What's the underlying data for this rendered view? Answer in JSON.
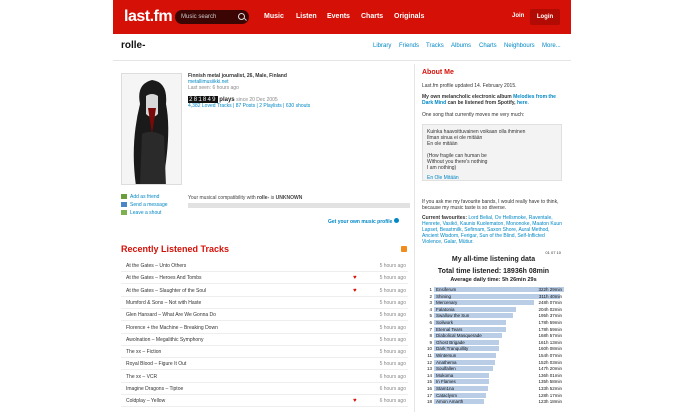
{
  "header": {
    "logo": "last.fm",
    "search_placeholder": "Music search",
    "nav": [
      "Music",
      "Listen",
      "Events",
      "Charts",
      "Originals"
    ],
    "join": "Join",
    "login": "Login"
  },
  "profile": {
    "username": "rolle-",
    "subnav": [
      "Library",
      "Friends",
      "Tracks",
      "Albums",
      "Charts",
      "Neighbours",
      "More..."
    ],
    "bio_line1": "Finnish metal journalist, 26, Male, Finland",
    "bio_line2": "metallimusiikki.net",
    "bio_line3": "Last seen: 6 hours ago",
    "scrobbles": "281849",
    "plays_label": "plays",
    "since": "since 20 Dec 2005",
    "links": "4,382 Loved Tracks | 87 Posts | 2 Playlists | 630 shouts",
    "actions": [
      "Add as friend",
      "Send a message",
      "Leave a shout"
    ],
    "compat_prefix": "Your musical compatibility with",
    "compat_user": "rolle-",
    "compat_suffix": "is",
    "compat_level": "UNKNOWN",
    "get_own": "Get your own music profile"
  },
  "recent": {
    "title": "Recently Listened Tracks",
    "tracks": [
      {
        "title": "At the Gates – Unto Others",
        "loved": false,
        "time": "5 hours ago"
      },
      {
        "title": "At the Gates – Heroes And Tombs",
        "loved": true,
        "time": "5 hours ago"
      },
      {
        "title": "At the Gates – Slaughter of the Soul",
        "loved": true,
        "time": "5 hours ago"
      },
      {
        "title": "Mumford & Sons – Not with Haste",
        "loved": false,
        "time": "5 hours ago"
      },
      {
        "title": "Glen Hansard – What Are We Gonna Do",
        "loved": false,
        "time": "5 hours ago"
      },
      {
        "title": "Florence + the Machine – Breaking Down",
        "loved": false,
        "time": "5 hours ago"
      },
      {
        "title": "Awolnation – Megalithic Symphony",
        "loved": false,
        "time": "5 hours ago"
      },
      {
        "title": "The xx – Fiction",
        "loved": false,
        "time": "5 hours ago"
      },
      {
        "title": "Royal Blood – Figure It Out",
        "loved": false,
        "time": "5 hours ago"
      },
      {
        "title": "The xx – VCR",
        "loved": false,
        "time": "6 hours ago"
      },
      {
        "title": "Imagine Dragons – Tiptoe",
        "loved": false,
        "time": "6 hours ago"
      },
      {
        "title": "Coldplay – Yellow",
        "loved": true,
        "time": "6 hours ago"
      }
    ]
  },
  "about": {
    "title": "About Me",
    "updated": "Last.fm profile updated 14. February 2015.",
    "album_pre": "My own melancholic electronic album",
    "album_name": "Melodies from the Dark Mind",
    "album_post": "can be listened from Spotify,",
    "album_link": "here",
    "one_song": "One song that currently moves me very much:",
    "lyrics": "Kuinka haavoittuvainen voikaan olla ihminen\nIlman sinua ei ole mitään\nEn ole mitään\n\n(How fragile can human be\nWithout you there's nothing\nI am nothing)",
    "lyrics_link": "En Ole Mitään",
    "fav_intro": "If you ask me my favourite bands, I would really have to think, because my music taste is so diverse.",
    "fav_label": "Current favourites:",
    "fav_list": "Lord Belial, Ov Hellsmoke, Raventale, Henrete, Vasikö, Kaunis Kuolematon, Mononoke, Maaton Kuun Lapset, Beastmilk, Sefirnam, Saxon Shore, Aural Method, Ancient Wisdom, Ferigar, Sun of the Blind, Self-Inflicted Violence, Galar, Mütiur."
  },
  "listening_chart": {
    "corner": "01 07 10",
    "title": "My all-time listening data",
    "total": "Total time listened: 18936h 08min",
    "average": "Average daily time: 5h 26min 29s",
    "bars": [
      {
        "rank": "1",
        "artist": "Ensiferum",
        "value": "322h 29min",
        "hours": 322
      },
      {
        "rank": "2",
        "artist": "Shining",
        "value": "311h 40min",
        "hours": 311
      },
      {
        "rank": "3",
        "artist": "Mercenary",
        "value": "248h 07min",
        "hours": 248
      },
      {
        "rank": "4",
        "artist": "Falatonia",
        "value": "204h 02min",
        "hours": 204
      },
      {
        "rank": "5",
        "artist": "Swallow the Sun",
        "value": "195h 37min",
        "hours": 195
      },
      {
        "rank": "6",
        "artist": "Soilwork",
        "value": "178h 59min",
        "hours": 178
      },
      {
        "rank": "7",
        "artist": "Eternal Tears",
        "value": "178h 59min",
        "hours": 178
      },
      {
        "rank": "8",
        "artist": "Diabolical Masquerade",
        "value": "168h 57min",
        "hours": 168
      },
      {
        "rank": "9",
        "artist": "Ghost Brigade",
        "value": "161h 13min",
        "hours": 161
      },
      {
        "rank": "10",
        "artist": "Dark Tranquillity",
        "value": "160h 08min",
        "hours": 160
      },
      {
        "rank": "11",
        "artist": "Wintersun",
        "value": "154h 07min",
        "hours": 154
      },
      {
        "rank": "12",
        "artist": "Anathema",
        "value": "152h 03min",
        "hours": 152
      },
      {
        "rank": "13",
        "artist": "Soulfallen",
        "value": "147h 20min",
        "hours": 147
      },
      {
        "rank": "14",
        "artist": "Mokoma",
        "value": "136h 01min",
        "hours": 136
      },
      {
        "rank": "15",
        "artist": "In Flames",
        "value": "135h 58min",
        "hours": 135
      },
      {
        "rank": "16",
        "artist": "Stam1na",
        "value": "133h 52min",
        "hours": 133
      },
      {
        "rank": "17",
        "artist": "Cataclysm",
        "value": "128h 17min",
        "hours": 128
      },
      {
        "rank": "18",
        "artist": "Amon Amarth",
        "value": "123h 18min",
        "hours": 123
      }
    ]
  },
  "colors": {
    "brand_red": "#d51007",
    "link_blue": "#0187c5",
    "bar_fill": "#b9cde6"
  }
}
